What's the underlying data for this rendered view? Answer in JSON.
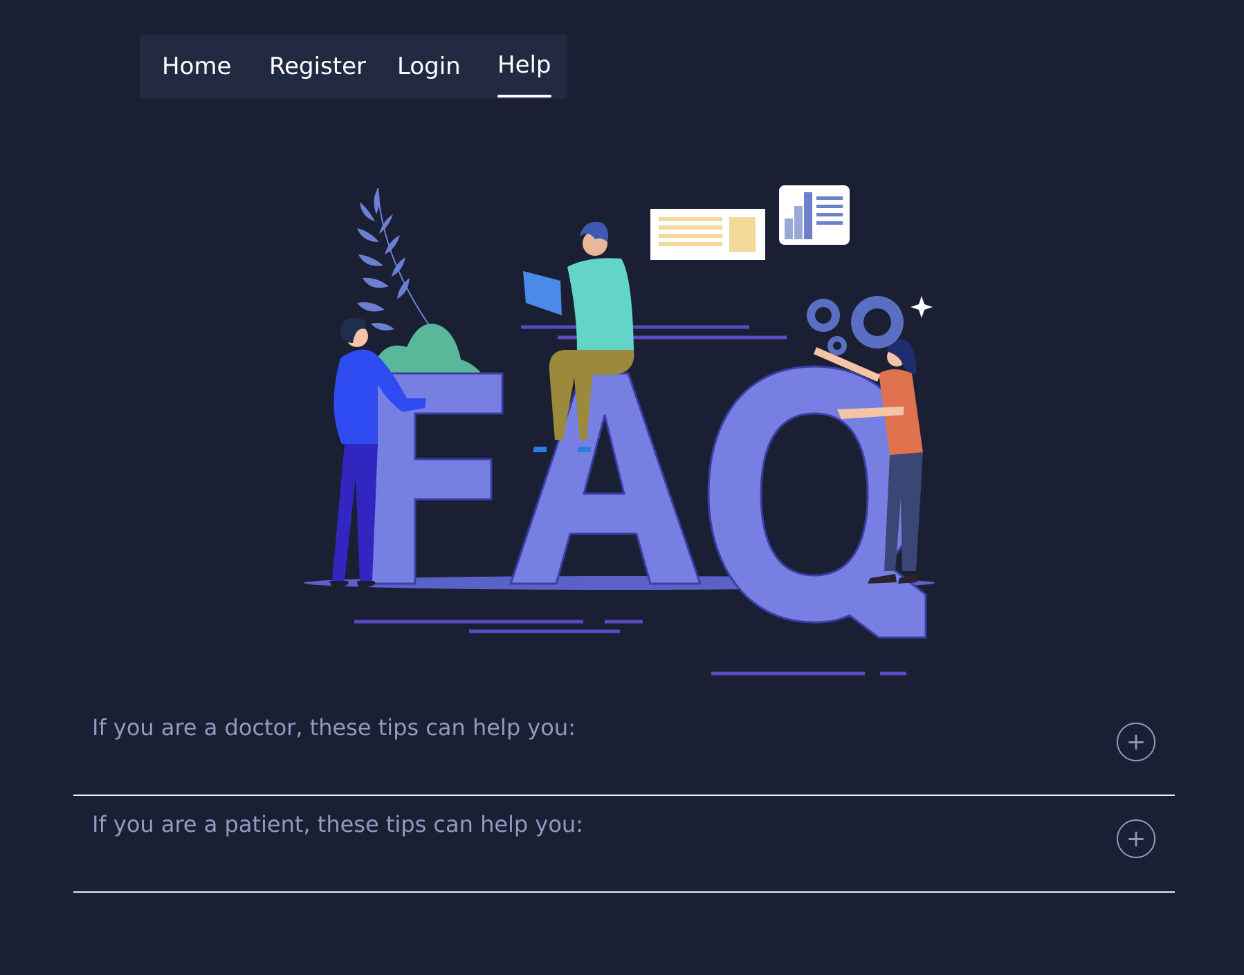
{
  "nav": {
    "items": [
      {
        "label": "Home"
      },
      {
        "label": "Register"
      },
      {
        "label": "Login"
      },
      {
        "label": "Help",
        "active": true
      }
    ]
  },
  "hero": {
    "illustration_text": "FAQ",
    "illustration_icon": "faq-illustration"
  },
  "faq": {
    "items": [
      {
        "question": "If you are a doctor, these tips can help you:",
        "toggle": "+"
      },
      {
        "question": "If you are a patient, these tips can help you:",
        "toggle": "+"
      }
    ]
  },
  "colors": {
    "background": "#1b1f33",
    "nav_background": "#222a42",
    "letter_fill": "#7780e2",
    "question_text": "#8d9cc0",
    "divider": "#e8ecf5"
  }
}
